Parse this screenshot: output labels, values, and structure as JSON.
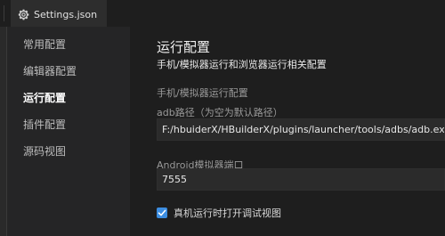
{
  "tab": {
    "title": "Settings.json",
    "icon": "gear-icon"
  },
  "nav": {
    "items": [
      {
        "label": "常用配置",
        "active": false
      },
      {
        "label": "编辑器配置",
        "active": false
      },
      {
        "label": "运行配置",
        "active": true
      },
      {
        "label": "插件配置",
        "active": false
      },
      {
        "label": "源码视图",
        "active": false
      }
    ]
  },
  "content": {
    "title": "运行配置",
    "subtitle": "手机/模拟器运行和浏览器运行相关配置",
    "section_title": "手机/模拟器运行配置",
    "adb": {
      "label": "adb路径（为空为默认路径）",
      "value": "F:/hbuiderX/HBuilderX/plugins/launcher/tools/adbs/adb.exe"
    },
    "port": {
      "label": "Android模拟器端口",
      "value": "7555"
    },
    "debug_checkbox": {
      "label": "真机运行时打开调试视图",
      "checked": true
    }
  },
  "colors": {
    "accent": "#3c8de0",
    "background": "#1e1e1e",
    "sidebar": "#252526"
  }
}
